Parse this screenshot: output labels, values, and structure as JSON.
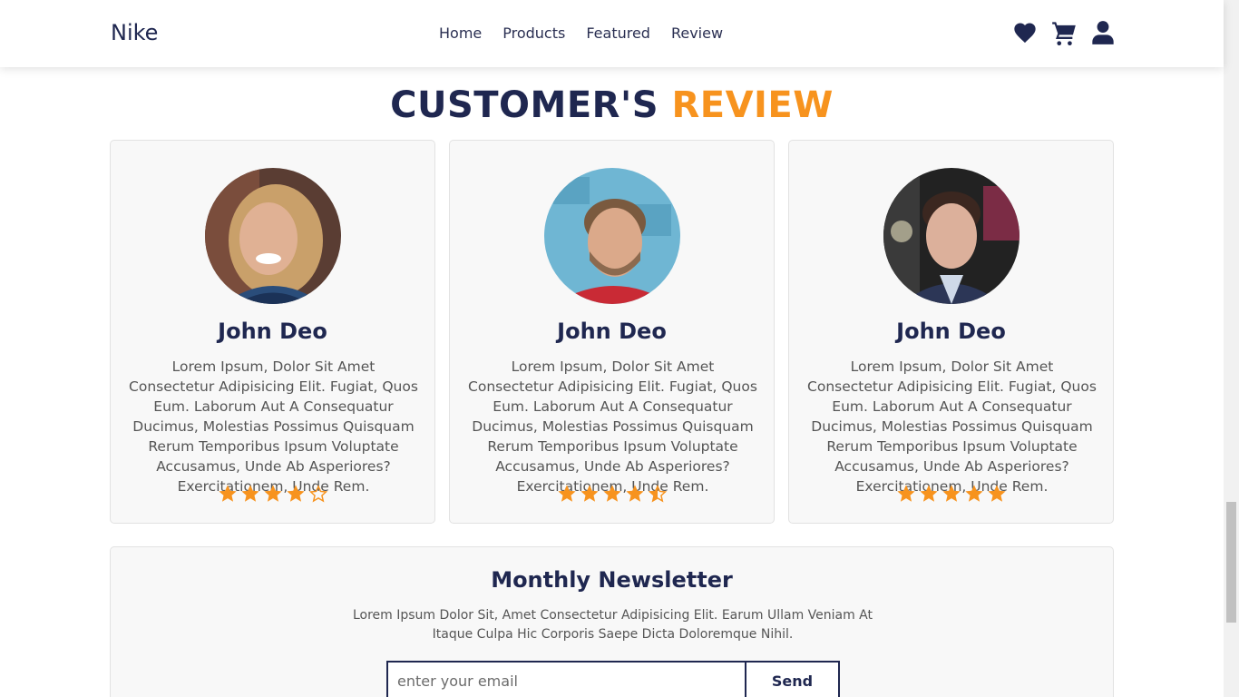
{
  "nav": {
    "brand": "Nike",
    "links": [
      "Home",
      "Products",
      "Featured",
      "Review"
    ],
    "icons": [
      "heart-icon",
      "cart-icon",
      "user-icon"
    ],
    "icon_color": "#1f2750"
  },
  "review_section": {
    "title_part1": "CUSTOMER'S",
    "title_part2": "REVIEW",
    "accent_color": "#f7931e",
    "cards": [
      {
        "name": "John Deo",
        "text": "Lorem Ipsum, Dolor Sit Amet Consectetur Adipisicing Elit. Fugiat, Quos Eum. Laborum Aut A Consequatur Ducimus, Molestias Possimus Quisquam Rerum Temporibus Ipsum Voluptate Accusamus, Unde Ab Asperiores? Exercitationem, Unde Rem.",
        "rating": 4
      },
      {
        "name": "John Deo",
        "text": "Lorem Ipsum, Dolor Sit Amet Consectetur Adipisicing Elit. Fugiat, Quos Eum. Laborum Aut A Consequatur Ducimus, Molestias Possimus Quisquam Rerum Temporibus Ipsum Voluptate Accusamus, Unde Ab Asperiores? Exercitationem, Unde Rem.",
        "rating": 4.5
      },
      {
        "name": "John Deo",
        "text": "Lorem Ipsum, Dolor Sit Amet Consectetur Adipisicing Elit. Fugiat, Quos Eum. Laborum Aut A Consequatur Ducimus, Molestias Possimus Quisquam Rerum Temporibus Ipsum Voluptate Accusamus, Unde Ab Asperiores? Exercitationem, Unde Rem.",
        "rating": 5
      }
    ]
  },
  "newsletter": {
    "title": "Monthly Newsletter",
    "text": "Lorem Ipsum Dolor Sit, Amet Consectetur Adipisicing Elit. Earum Ullam Veniam At Itaque Culpa Hic Corporis Saepe Dicta Doloremque Nihil.",
    "placeholder": "enter your email",
    "button_label": "Send"
  }
}
